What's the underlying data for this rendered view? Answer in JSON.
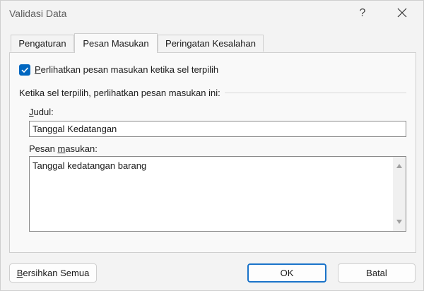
{
  "dialog": {
    "title": "Validasi Data",
    "help_label": "?"
  },
  "tabs": [
    {
      "label": "Pengaturan",
      "active": false
    },
    {
      "label": "Pesan Masukan",
      "active": true
    },
    {
      "label": "Peringatan Kesalahan",
      "active": false
    }
  ],
  "input_message": {
    "show_checkbox": {
      "checked": true,
      "label_first": "P",
      "label_rest": "erlihatkan pesan masukan ketika sel terpilih"
    },
    "group_label": "Ketika sel terpilih, perlihatkan pesan masukan ini:",
    "title_label_first": "J",
    "title_label_rest": "udul:",
    "title_value": "Tanggal Kedatangan",
    "message_label_first": "Pesan ",
    "message_label_underline": "m",
    "message_label_rest": "asukan:",
    "message_value": "Tanggal kedatangan barang"
  },
  "buttons": {
    "clear_first": "B",
    "clear_rest": "ersihkan Semua",
    "ok": "OK",
    "cancel": "Batal"
  },
  "colors": {
    "accent": "#0067c0",
    "ok_border": "#1a73c9"
  },
  "icons": {
    "close": "close-icon",
    "checkmark": "checkmark-icon",
    "scroll_up": "triangle-up-icon",
    "scroll_down": "triangle-down-icon"
  }
}
